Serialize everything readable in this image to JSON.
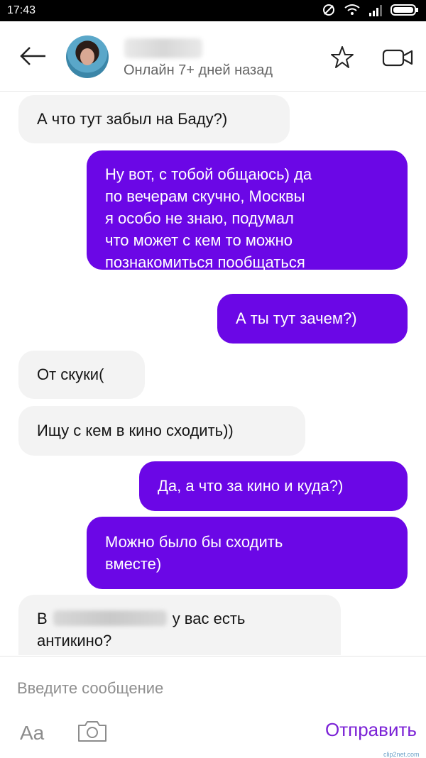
{
  "status_bar": {
    "time": "17:43"
  },
  "header": {
    "contact_status": "Онлайн 7+ дней назад"
  },
  "messages": [
    {
      "dir": "in",
      "text": "А что тут забыл на Баду?)"
    },
    {
      "dir": "out",
      "lines": [
        "Ну вот, с тобой общаюсь)  да",
        "по вечерам скучно, Москвы",
        "я особо не знаю, подумал",
        "что может с кем то можно",
        "познакомиться пообщаться"
      ]
    },
    {
      "dir": "out",
      "text": "А ты тут зачем?)"
    },
    {
      "dir": "in",
      "text": "От скуки("
    },
    {
      "dir": "in",
      "text": "Ищу с кем в кино сходить))"
    },
    {
      "dir": "out",
      "text": "Да, а что за кино и куда?)"
    },
    {
      "dir": "out",
      "lines": [
        "Можно было бы сходить",
        "вместе)"
      ]
    },
    {
      "dir": "in",
      "parts": {
        "prefix": "В",
        "suffix": "у вас есть",
        "line2": "антикино?"
      }
    }
  ],
  "input": {
    "placeholder": "Введите сообщение",
    "format_label": "Aa",
    "send_label": "Отправить"
  },
  "watermark": "clip2net.com",
  "colors": {
    "accent": "#6b07e6",
    "send_text": "#7b22d6",
    "incoming_bg": "#f3f3f3"
  }
}
